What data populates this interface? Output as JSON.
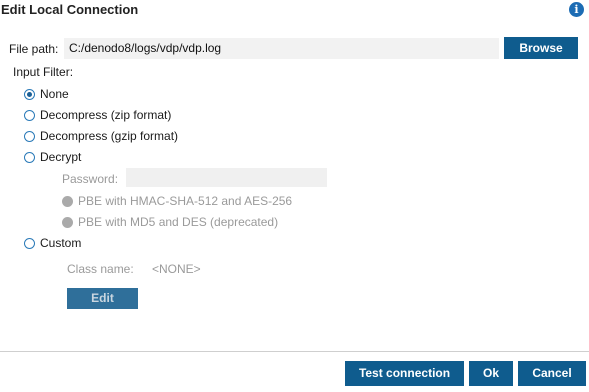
{
  "dialog": {
    "title": "Edit Local Connection",
    "info_icon": "info-icon",
    "info_glyph": "i"
  },
  "file_path": {
    "label": "File path:",
    "value": "C:/denodo8/logs/vdp/vdp.log",
    "browse_label": "Browse"
  },
  "input_filter": {
    "label": "Input Filter:",
    "options": [
      {
        "label": "None",
        "selected": true
      },
      {
        "label": "Decompress (zip format)",
        "selected": false
      },
      {
        "label": "Decompress (gzip format)",
        "selected": false
      },
      {
        "label": "Decrypt",
        "selected": false
      },
      {
        "label": "Custom",
        "selected": false
      }
    ],
    "decrypt": {
      "password_label": "Password:",
      "password_value": "",
      "algorithms": [
        {
          "label": "PBE with HMAC-SHA-512 and AES-256",
          "enabled": false
        },
        {
          "label": "PBE with MD5 and DES (deprecated)",
          "enabled": false
        }
      ]
    },
    "custom": {
      "class_name_label": "Class name:",
      "class_name_value": "<NONE>",
      "edit_label": "Edit"
    }
  },
  "footer": {
    "test_connection_label": "Test connection",
    "ok_label": "Ok",
    "cancel_label": "Cancel"
  },
  "colors": {
    "button_bg": "#0f5c8e",
    "radio_border": "#2a7ab8",
    "disabled_text": "#9a9a9a",
    "info_icon_bg": "#1c6cb4"
  }
}
